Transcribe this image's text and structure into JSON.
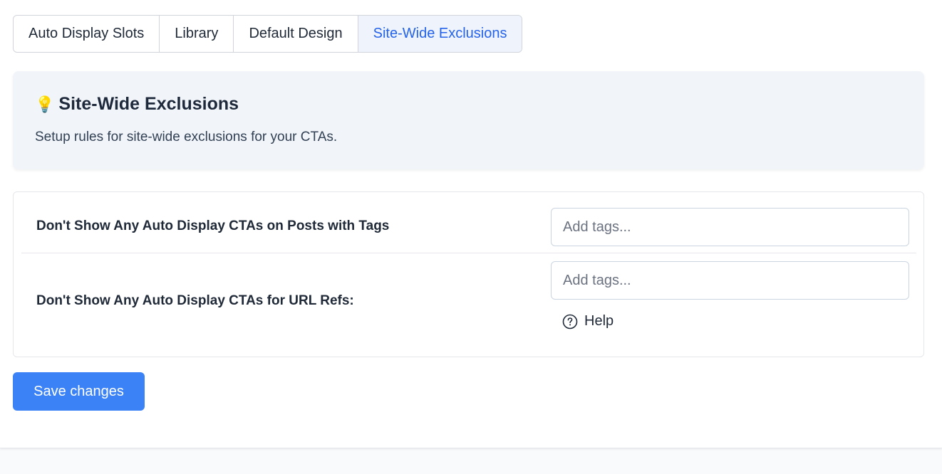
{
  "tabs": [
    {
      "label": "Auto Display Slots",
      "active": false
    },
    {
      "label": "Library",
      "active": false
    },
    {
      "label": "Default Design",
      "active": false
    },
    {
      "label": "Site-Wide Exclusions",
      "active": true
    }
  ],
  "info": {
    "icon": "lightbulb-icon",
    "title": "Site-Wide Exclusions",
    "description": "Setup rules for site-wide exclusions for your CTAs."
  },
  "settings": {
    "tags_exclusion": {
      "label": "Don't Show Any Auto Display CTAs on Posts with Tags",
      "value": "",
      "placeholder": "Add tags..."
    },
    "url_refs_exclusion": {
      "label": "Don't Show Any Auto Display CTAs for URL Refs:",
      "value": "",
      "placeholder": "Add tags...",
      "help_label": "Help",
      "help_icon": "question-circle-icon"
    }
  },
  "actions": {
    "save_label": "Save changes"
  },
  "colors": {
    "accent": "#3b82f6",
    "active_tab_text": "#2563eb",
    "active_tab_bg": "#eff4fc",
    "info_bg": "#f1f5f9"
  }
}
